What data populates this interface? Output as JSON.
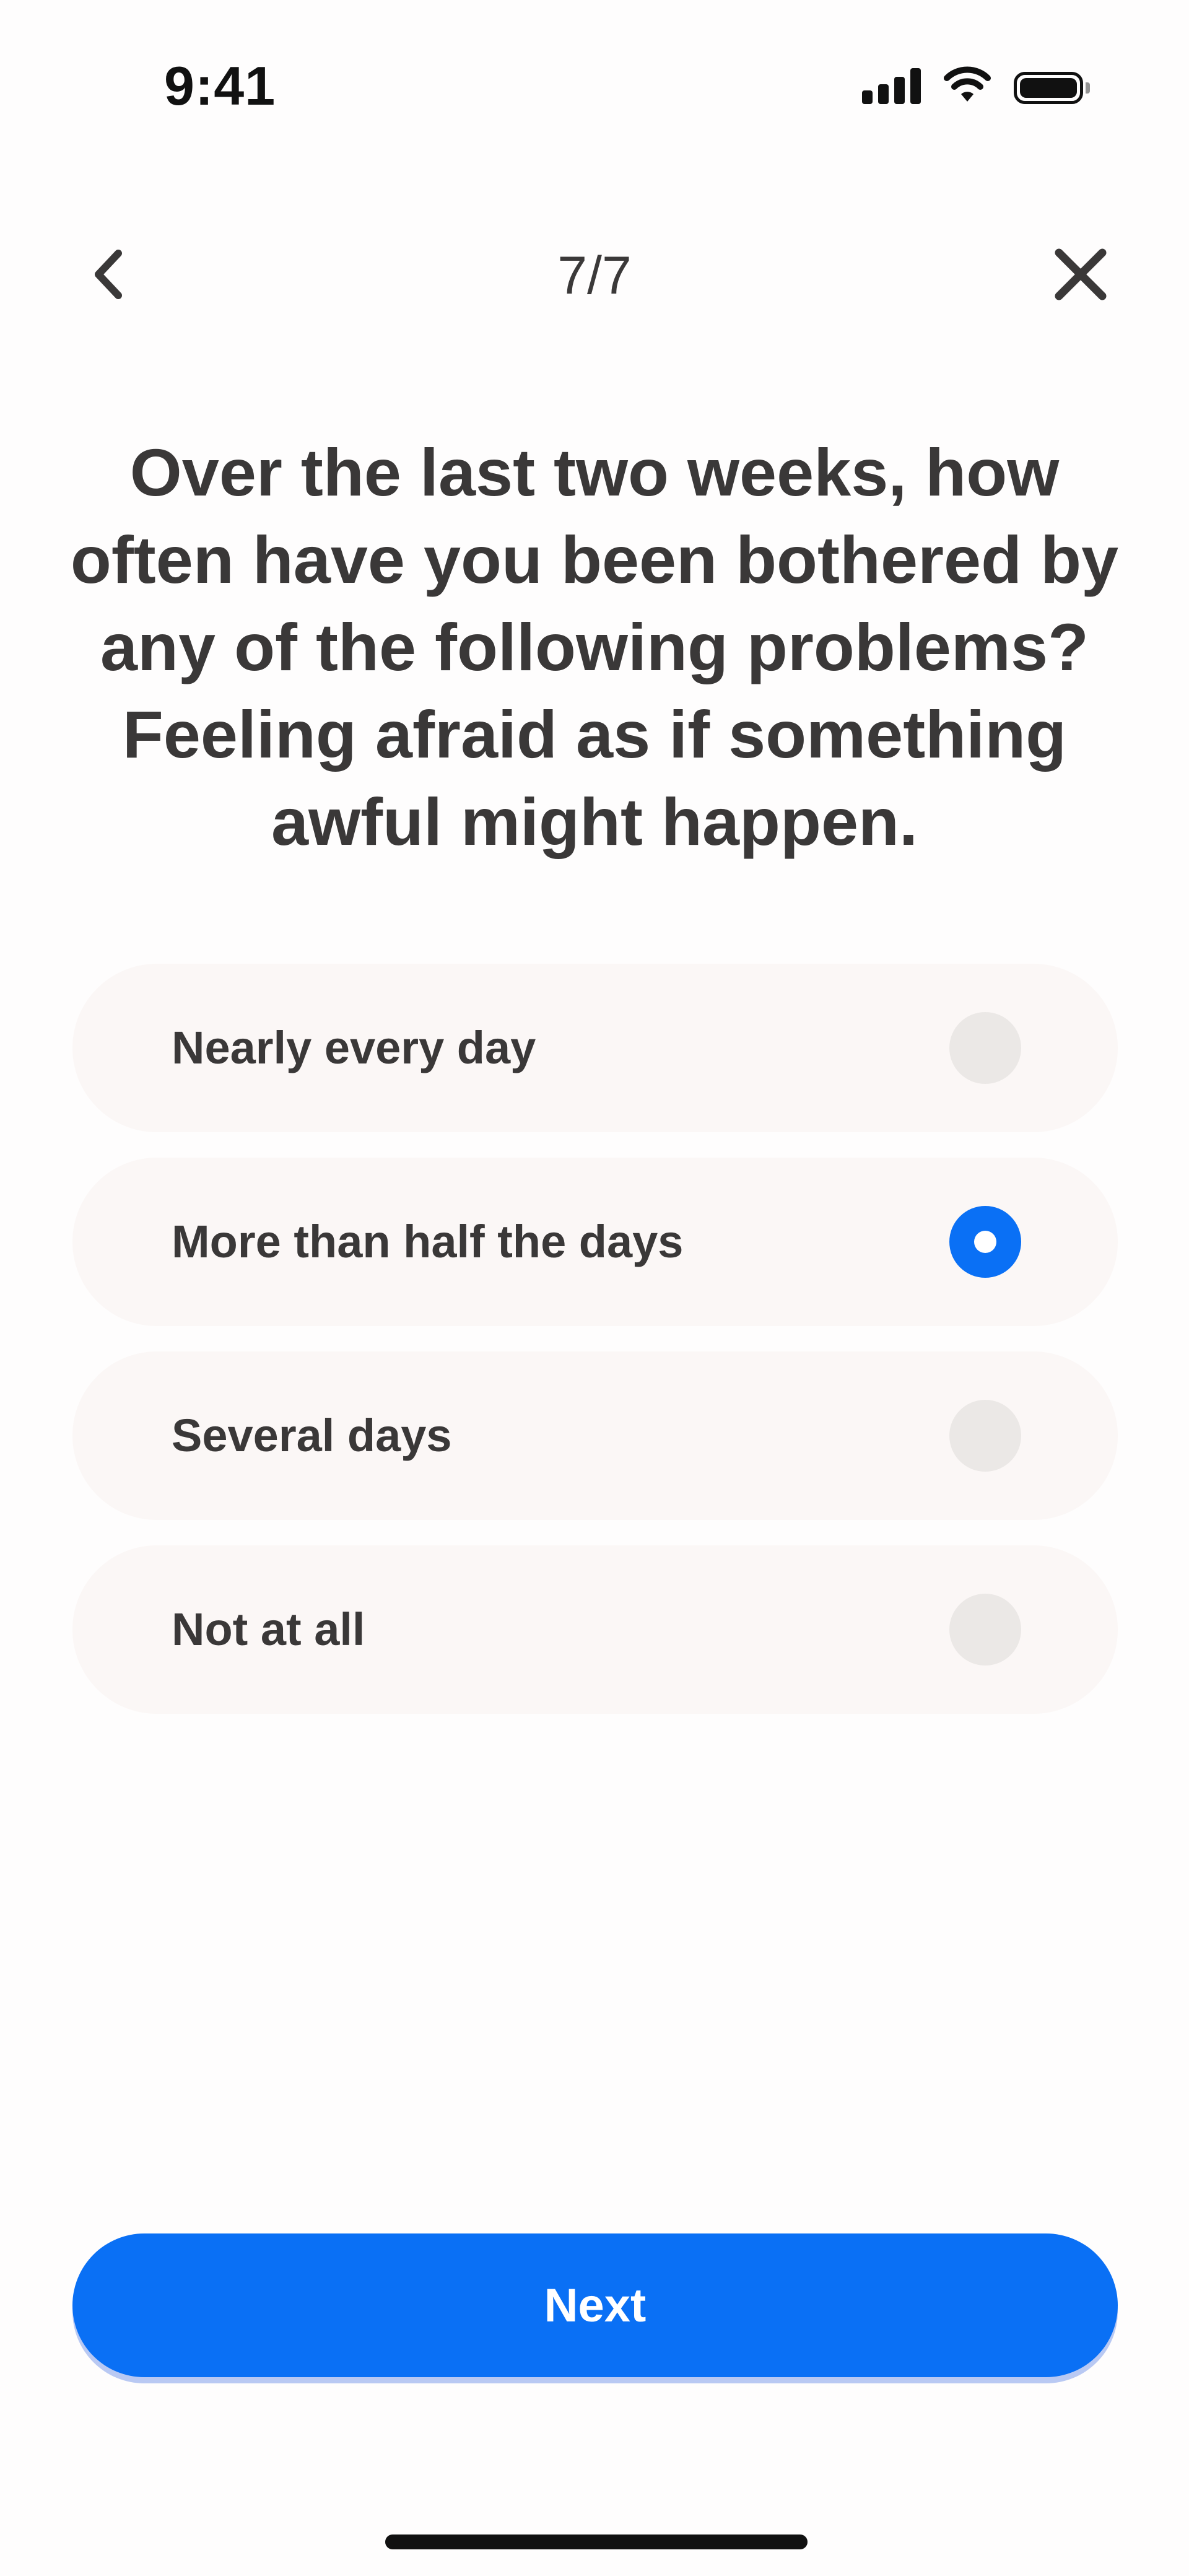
{
  "status_bar": {
    "time": "9:41",
    "icons": [
      "cellular-signal-icon",
      "wifi-icon",
      "battery-icon"
    ]
  },
  "nav": {
    "progress": "7/7",
    "back_icon": "chevron-left-icon",
    "close_icon": "close-icon"
  },
  "question": {
    "text": "Over the last two weeks, how often have you been bothered by any of the following problems? Feeling afraid as if something awful might happen."
  },
  "options": [
    {
      "label": "Nearly every day",
      "selected": false
    },
    {
      "label": "More than half the days",
      "selected": true
    },
    {
      "label": "Several days",
      "selected": false
    },
    {
      "label": "Not at all",
      "selected": false
    }
  ],
  "next_button": {
    "label": "Next"
  },
  "colors": {
    "accent": "#0a70f5",
    "option_background": "#fbf7f6",
    "radio_unselected": "#ebe8e6",
    "text": "#3a3838"
  }
}
